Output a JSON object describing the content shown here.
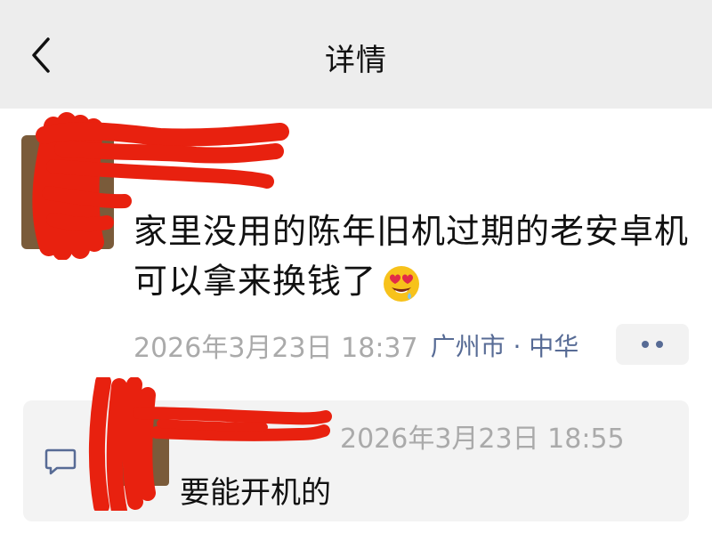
{
  "header": {
    "title": "详情",
    "back_icon": "chevron-left-icon"
  },
  "post": {
    "author": "",
    "text": "家里没用的陈年旧机过期的老安卓机可以拿来换钱了",
    "emoji": "heart-eyes-emoji",
    "timestamp": "2026年3月23日 18:37",
    "location": "广州市 · 中华",
    "more_icon": "more-dots-icon"
  },
  "comments": {
    "icon": "comment-icon",
    "items": [
      {
        "author": "",
        "time": "2026年3月23日 18:55",
        "text": "要能开机的"
      }
    ]
  },
  "colors": {
    "header_bg": "#ededed",
    "link": "#576b95",
    "meta": "#aaaaaa",
    "redaction": "#e8210f"
  }
}
